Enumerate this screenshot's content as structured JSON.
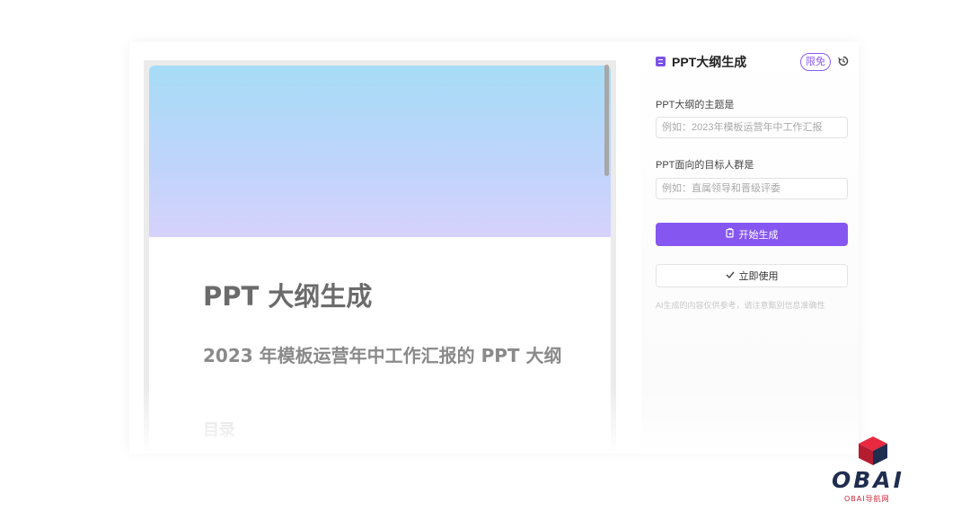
{
  "preview": {
    "doc_title": "PPT 大纲生成",
    "doc_subtitle": "2023 年模板运营年中工作汇报的 PPT 大纲",
    "doc_toc": "目录"
  },
  "panel": {
    "title": "PPT大纲生成",
    "badge": "限免",
    "field1": {
      "label": "PPT大纲的主题是",
      "placeholder": "例如：2023年模板运营年中工作汇报"
    },
    "field2": {
      "label": "PPT面向的目标人群是",
      "placeholder": "例如：直属领导和晋级评委"
    },
    "generate_label": "开始生成",
    "use_label": "立即使用",
    "disclaimer": "AI生成的内容仅供参考，请注意甄别信息准确性"
  },
  "watermark": {
    "logo_text": "OBAI",
    "sub_text": "OBAI导航网"
  },
  "icons": {
    "app": "document-icon",
    "history": "history-icon",
    "generate": "copy-icon",
    "use": "check-icon"
  },
  "colors": {
    "accent": "#8656f0",
    "badge": "#8b5cf6",
    "logo_red": "#d0243a",
    "logo_navy": "#1f2d4f"
  }
}
